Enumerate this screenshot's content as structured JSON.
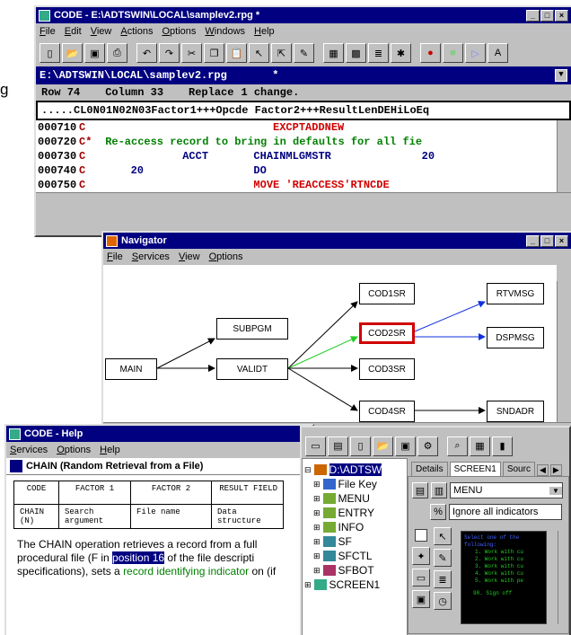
{
  "code_window": {
    "title": "CODE - E:\\ADTSWIN\\LOCAL\\samplev2.rpg  *",
    "menu": [
      "File",
      "Edit",
      "View",
      "Actions",
      "Options",
      "Windows",
      "Help"
    ],
    "path": "E:\\ADTSWIN\\LOCAL\\samplev2.rpg       *",
    "status": {
      "row": "Row 74",
      "column": "Column 33",
      "mode": "Replace",
      "changes": "1 change."
    },
    "ruler": ".....CL0N01N02N03Factor1+++Opcde Factor2+++ResultLenDEHiLoEq",
    "lines": [
      {
        "num": "000710",
        "spec": "C",
        "text": "                         EXCPTADDNEW"
      },
      {
        "num": "000720",
        "spec": "C*",
        "text": " Re-access record to bring in defaults for all fie"
      },
      {
        "num": "000730",
        "spec": "C",
        "text": "           ACCT       CHAINMLGMSTR              20"
      },
      {
        "num": "000740",
        "spec": "C",
        "text": "   20                 DO"
      },
      {
        "num": "000750",
        "spec": "C",
        "text": "                      MOVE 'REACCESS'RTNCDE"
      }
    ],
    "stray_char": "g"
  },
  "navigator": {
    "title": "Navigator",
    "menu": [
      "File",
      "Services",
      "View",
      "Options"
    ],
    "nodes": {
      "main": "MAIN",
      "subpgm": "SUBPGM",
      "validt": "VALIDT",
      "cod1sr": "COD1SR",
      "cod2sr": "COD2SR",
      "cod3sr": "COD3SR",
      "cod4sr": "COD4SR",
      "rtvmsg": "RTVMSG",
      "dspmsg": "DSPMSG",
      "sndadr": "SNDADR"
    }
  },
  "help": {
    "title": "CODE - Help",
    "menu": [
      "Services",
      "Options",
      "Help"
    ],
    "heading": "CHAIN (Random Retrieval from a File)",
    "table_headers": [
      "CODE",
      "FACTOR 1",
      "FACTOR 2",
      "RESULT FIELD"
    ],
    "table_row": [
      "CHAIN (N)",
      "Search argument",
      "File name",
      "Data structure"
    ],
    "para1": "The CHAIN operation retrieves a record from a full",
    "para2a": "procedural file (F in ",
    "para2_hl": "position 16",
    "para2b": " of the file descripti",
    "para3a": "specifications), sets a ",
    "para3_link": "record identifying indicator",
    "para3b": " on (if"
  },
  "designer": {
    "tree": [
      "D:\\ADTSW",
      "File Key",
      "MENU",
      "ENTRY",
      "INFO",
      "SF",
      "SFCTL",
      "SFBOT",
      "SCREEN1"
    ],
    "tabs": [
      "Details",
      "SCREEN1",
      "Sourc"
    ],
    "record_select": "MENU",
    "indicator_select": "Ignore all indicators",
    "preview_lines": [
      "Select one of the following:",
      "1. Work with cu",
      "2. Work with cu",
      "3. Work with cu",
      "4. Work with cu",
      "5. Work with pe",
      "90. Sign off"
    ]
  },
  "colors": {
    "titlebar": "#000080",
    "highlight": "#d00000",
    "green_edge": "#22cc22",
    "blue_edge": "#1030e0"
  }
}
